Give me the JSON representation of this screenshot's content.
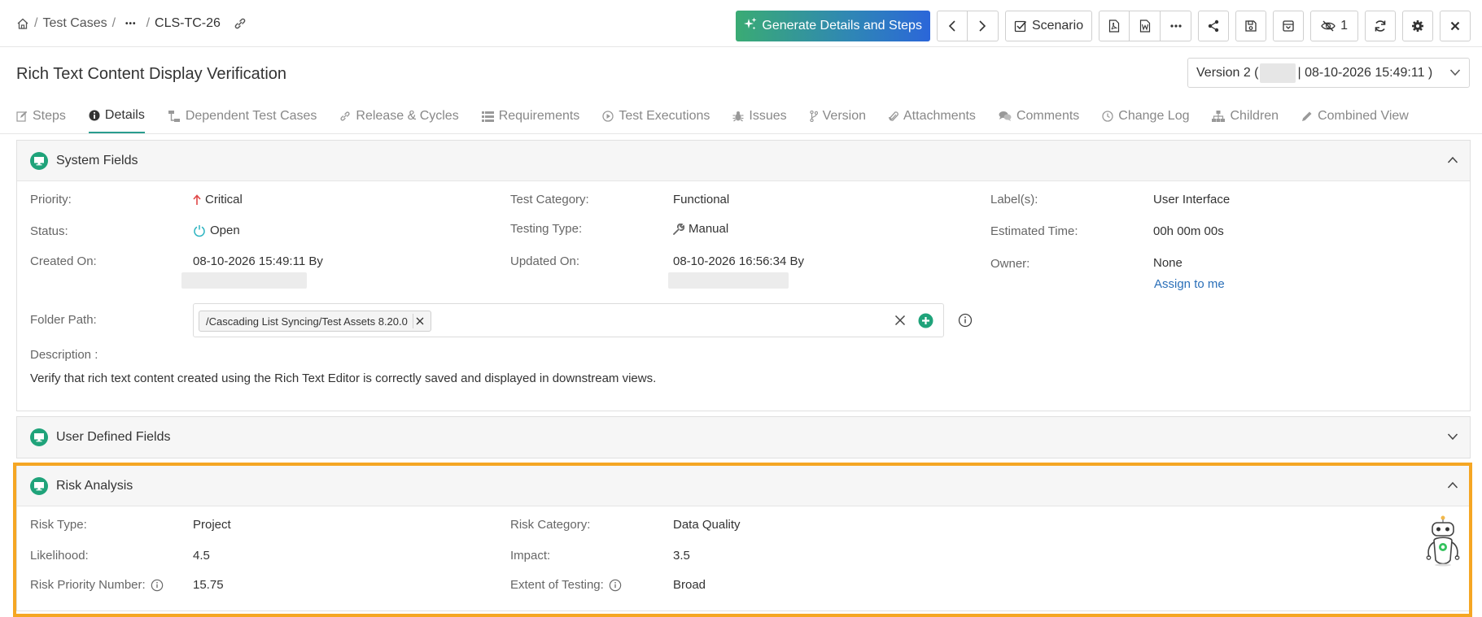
{
  "breadcrumb": {
    "parent": "Test Cases",
    "separator": "/",
    "ellipsis": "•••",
    "current": "CLS-TC-26"
  },
  "toolbar": {
    "generate_label": "Generate Details and Steps",
    "scenario_label": "Scenario",
    "watch_count": "1"
  },
  "title": "Rich Text Content Display Verification",
  "version": {
    "prefix": "Version 2 (",
    "suffix": "| 08-10-2026 15:49:11 )"
  },
  "tabs": [
    {
      "label": "Steps",
      "icon": "edit-icon"
    },
    {
      "label": "Details",
      "icon": "info-icon"
    },
    {
      "label": "Dependent Test Cases",
      "icon": "dependency-icon"
    },
    {
      "label": "Release & Cycles",
      "icon": "link-icon"
    },
    {
      "label": "Requirements",
      "icon": "list-icon"
    },
    {
      "label": "Test Executions",
      "icon": "play-icon"
    },
    {
      "label": "Issues",
      "icon": "bug-icon"
    },
    {
      "label": "Version",
      "icon": "branch-icon"
    },
    {
      "label": "Attachments",
      "icon": "paperclip-icon"
    },
    {
      "label": "Comments",
      "icon": "comments-icon"
    },
    {
      "label": "Change Log",
      "icon": "clock-icon"
    },
    {
      "label": "Children",
      "icon": "hierarchy-icon"
    },
    {
      "label": "Combined View",
      "icon": "pencil-icon"
    }
  ],
  "system_fields": {
    "title": "System Fields",
    "priority_label": "Priority:",
    "priority_value": "Critical",
    "status_label": "Status:",
    "status_value": "Open",
    "created_label": "Created On:",
    "created_value": "08-10-2026 15:49:11 By",
    "test_category_label": "Test Category:",
    "test_category_value": "Functional",
    "testing_type_label": "Testing Type:",
    "testing_type_value": "Manual",
    "updated_label": "Updated On:",
    "updated_value": "08-10-2026 16:56:34 By",
    "labels_label": "Label(s):",
    "labels_value": "User Interface",
    "estimated_label": "Estimated Time:",
    "estimated_value": "00h 00m 00s",
    "owner_label": "Owner:",
    "owner_value": "None",
    "assign_link": "Assign to me",
    "folder_label": "Folder Path:",
    "folder_value": "/Cascading List Syncing/Test Assets 8.20.0",
    "description_label": "Description :",
    "description_value": "Verify that rich text content created using the Rich Text Editor is correctly saved and displayed in downstream views."
  },
  "user_defined": {
    "title": "User Defined Fields"
  },
  "risk": {
    "title": "Risk Analysis",
    "risk_type_label": "Risk Type:",
    "risk_type_value": "Project",
    "risk_category_label": "Risk Category:",
    "risk_category_value": "Data Quality",
    "likelihood_label": "Likelihood:",
    "likelihood_value": "4.5",
    "impact_label": "Impact:",
    "impact_value": "3.5",
    "rpn_label": "Risk Priority Number:",
    "rpn_value": "15.75",
    "extent_label": "Extent of Testing:",
    "extent_value": "Broad"
  },
  "colors": {
    "accent": "#1fa37a",
    "highlight": "#f5a623",
    "critical": "#e04848",
    "open": "#2bb3c0",
    "link": "#2a6fb8"
  }
}
